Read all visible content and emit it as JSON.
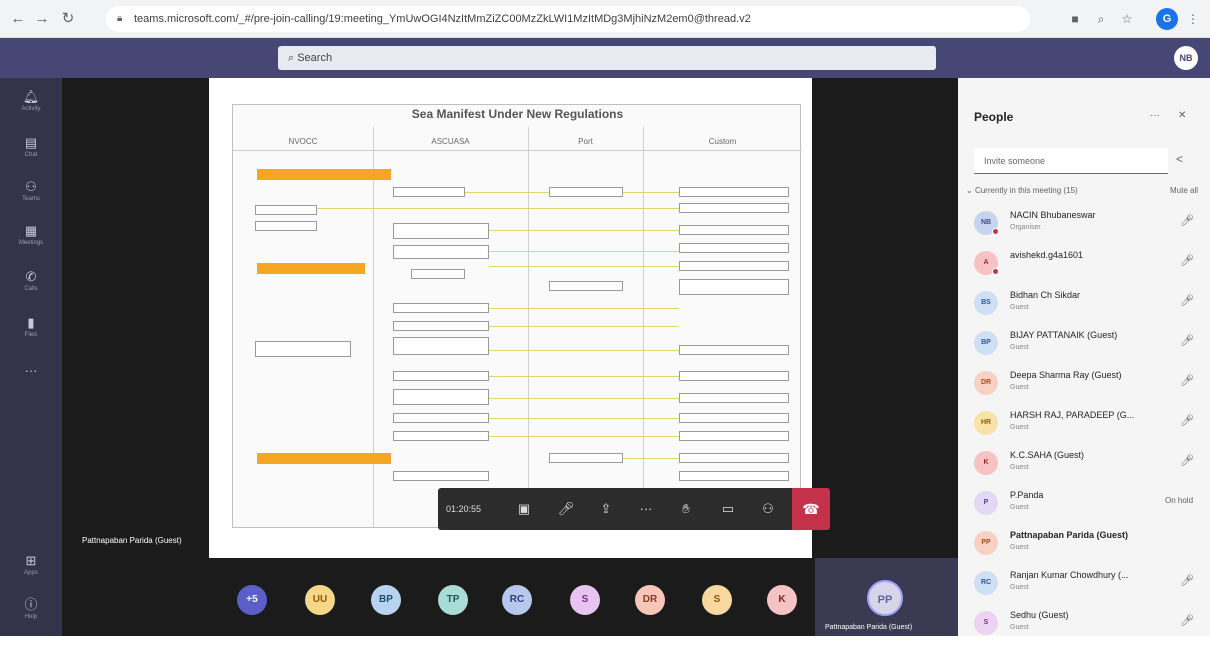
{
  "browser": {
    "back_icon": "back-arrow-icon",
    "url": "teams.microsoft.com/_#/pre-join-calling/19:meeting_YmUwOGI4NzItMmZiZC00MzZkLWI1MzItMDg3MjhiNzM2em0@thread.v2"
  },
  "header": {
    "search_placeholder": "Search",
    "avatar_initials": "NB"
  },
  "rail": {
    "items": [
      {
        "icon": "bell-icon",
        "label": "Activity"
      },
      {
        "icon": "chat-icon",
        "label": "Chat"
      },
      {
        "icon": "teams-icon",
        "label": "Teams"
      },
      {
        "icon": "calendar-icon",
        "label": "Meetings"
      },
      {
        "icon": "phone-icon",
        "label": "Calls"
      },
      {
        "icon": "files-icon",
        "label": "Files"
      }
    ],
    "more": "···",
    "apps_label": "Apps",
    "help_label": "Help"
  },
  "slide": {
    "title": "Sea Manifest Under New Regulations",
    "lanes": [
      "NVOCC",
      "ASCUASA",
      "Port",
      "Custom"
    ]
  },
  "presenter_name": "Pattnapaban Parida (Guest)",
  "participants_strip": [
    {
      "initials": "+5",
      "bg": "#5b5fc7",
      "fg": "#ffffff"
    },
    {
      "initials": "UU",
      "bg": "#f5d78a",
      "fg": "#8a5a00"
    },
    {
      "initials": "BP",
      "bg": "#b7d3ef",
      "fg": "#1f4e79"
    },
    {
      "initials": "TP",
      "bg": "#a9dbd7",
      "fg": "#145e58"
    },
    {
      "initials": "RC",
      "bg": "#b8c7ec",
      "fg": "#2b3f7a"
    },
    {
      "initials": "S",
      "bg": "#e8c4f0",
      "fg": "#7a2e8a"
    },
    {
      "initials": "DR",
      "bg": "#f7c6b8",
      "fg": "#8c3a1e"
    },
    {
      "initials": "S",
      "bg": "#f7d9a0",
      "fg": "#8a5a00"
    },
    {
      "initials": "K",
      "bg": "#f5c3c3",
      "fg": "#8a2020"
    }
  ],
  "self_tile": {
    "initials": "PP",
    "name": "Pattnapaban Parida (Guest)"
  },
  "controls": {
    "timer": "01:20:55"
  },
  "people": {
    "title": "People",
    "invite_placeholder": "Invite someone",
    "section": "Currently in this meeting (15)",
    "mute_all": "Mute all",
    "list": [
      {
        "initials": "NB",
        "name": "NACIN Bhubaneswar",
        "role": "Organiser",
        "bg": "#c7d4f0",
        "fg": "#3b4f8a",
        "bold": false,
        "status": "mic",
        "dot": true
      },
      {
        "initials": "A",
        "name": "avishekd.g4a1601",
        "role": "",
        "bg": "#f5c3c3",
        "fg": "#a4262c",
        "bold": false,
        "status": "mic",
        "dot": true
      },
      {
        "initials": "BS",
        "name": "Bidhan Ch Sikdar",
        "role": "Guest",
        "bg": "#cfe0f5",
        "fg": "#2b5797",
        "bold": false,
        "status": "mic",
        "dot": false
      },
      {
        "initials": "BP",
        "name": "BIJAY PATTANAIK (Guest)",
        "role": "Guest",
        "bg": "#cfe0f5",
        "fg": "#2b5797",
        "bold": false,
        "status": "mic",
        "dot": false
      },
      {
        "initials": "DR",
        "name": "Deepa Sharma Ray (Guest)",
        "role": "Guest",
        "bg": "#f7d2c4",
        "fg": "#a84a1c",
        "bold": false,
        "status": "mic",
        "dot": false
      },
      {
        "initials": "HR",
        "name": "HARSH RAJ, PARADEEP (G...",
        "role": "Guest",
        "bg": "#f7e3a8",
        "fg": "#8a6200",
        "bold": false,
        "status": "mic",
        "dot": false
      },
      {
        "initials": "K",
        "name": "K.C.SAHA (Guest)",
        "role": "Guest",
        "bg": "#f5c3c3",
        "fg": "#a4262c",
        "bold": false,
        "status": "mic",
        "dot": false
      },
      {
        "initials": "P",
        "name": "P.Panda",
        "role": "Guest",
        "bg": "#e3d9f5",
        "fg": "#5c3d99",
        "bold": false,
        "status": "On hold",
        "dot": false
      },
      {
        "initials": "PP",
        "name": "Pattnapaban Parida (Guest)",
        "role": "Guest",
        "bg": "#f7d2c4",
        "fg": "#a84a1c",
        "bold": true,
        "status": "",
        "dot": false
      },
      {
        "initials": "RC",
        "name": "Ranjan Kumar Chowdhury (...",
        "role": "Guest",
        "bg": "#cfe0f5",
        "fg": "#2b5797",
        "bold": false,
        "status": "mic",
        "dot": false
      },
      {
        "initials": "S",
        "name": "Sedhu (Guest)",
        "role": "Guest",
        "bg": "#ecd3f3",
        "fg": "#7a2e8a",
        "bold": false,
        "status": "mic",
        "dot": false
      }
    ]
  }
}
